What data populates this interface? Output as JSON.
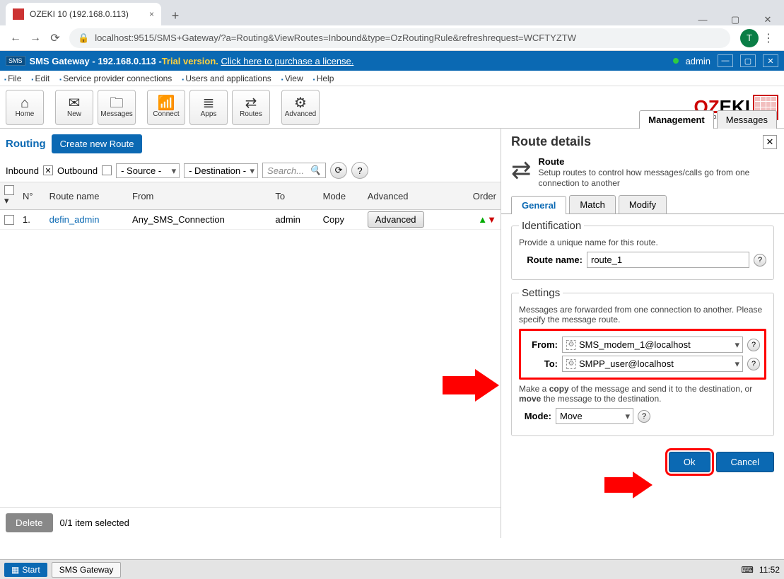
{
  "window": {
    "title": "OZEKI 10 (192.168.0.113)"
  },
  "browser": {
    "tab_title": "OZEKI 10 (192.168.0.113)",
    "url": "localhost:9515/SMS+Gateway/?a=Routing&ViewRoutes=Inbound&type=OzRoutingRule&refreshrequest=WCFTYZTW",
    "avatar_letter": "T"
  },
  "appbar": {
    "badge": "SMS",
    "title_prefix": "SMS Gateway - 192.168.0.113 - ",
    "trial": "Trial version.",
    "license_link": "Click here to purchase a license.",
    "user": "admin"
  },
  "menu": [
    "File",
    "Edit",
    "Service provider connections",
    "Users and applications",
    "View",
    "Help"
  ],
  "toolbar": [
    {
      "label": "Home",
      "icon": "⌂"
    },
    {
      "label": "New",
      "icon": "✉"
    },
    {
      "label": "Messages",
      "icon": "🗀"
    },
    {
      "label": "Connect",
      "icon": "📶"
    },
    {
      "label": "Apps",
      "icon": "≣"
    },
    {
      "label": "Routes",
      "icon": "⇄"
    },
    {
      "label": "Advanced",
      "icon": "⚙"
    }
  ],
  "logo_sub_prefix": "www.",
  "logo_sub_mid": "my",
  "logo_sub_brand": "ozeki",
  "logo_sub_suffix": ".com",
  "subtabs": {
    "management": "Management",
    "messages": "Messages"
  },
  "left": {
    "routing_label": "Routing",
    "create_btn": "Create new Route",
    "inbound": "Inbound",
    "outbound": "Outbound",
    "source_sel": "- Source -",
    "dest_sel": "- Destination -",
    "search_placeholder": "Search...",
    "cols": {
      "num": "N°",
      "name": "Route name",
      "from": "From",
      "to": "To",
      "mode": "Mode",
      "adv": "Advanced",
      "order": "Order"
    },
    "row": {
      "num": "1.",
      "name": "defin_admin",
      "from": "Any_SMS_Connection",
      "to": "admin",
      "mode": "Copy",
      "adv_btn": "Advanced"
    },
    "delete_btn": "Delete",
    "sel_text": "0/1 item selected"
  },
  "panel": {
    "title": "Route details",
    "head": "Route",
    "desc": "Setup routes to control how messages/calls go from one connection to another",
    "tabs": {
      "general": "General",
      "match": "Match",
      "modify": "Modify"
    },
    "id_legend": "Identification",
    "id_hint": "Provide a unique name for this route.",
    "route_name_label": "Route name:",
    "route_name_value": "route_1",
    "set_legend": "Settings",
    "set_hint": "Messages are forwarded from one connection to another. Please specify the message route.",
    "from_label": "From:",
    "from_value": "SMS_modem_1@localhost",
    "to_label": "To:",
    "to_value": "SMPP_user@localhost",
    "copy_hint_1": "Make a ",
    "copy_hint_b1": "copy",
    "copy_hint_2": " of the message and send it to the destination, or ",
    "copy_hint_b2": "move",
    "copy_hint_3": " the message to the destination.",
    "mode_label": "Mode:",
    "mode_value": "Move",
    "ok": "Ok",
    "cancel": "Cancel"
  },
  "taskbar": {
    "start": "Start",
    "task": "SMS Gateway",
    "time": "11:52"
  }
}
